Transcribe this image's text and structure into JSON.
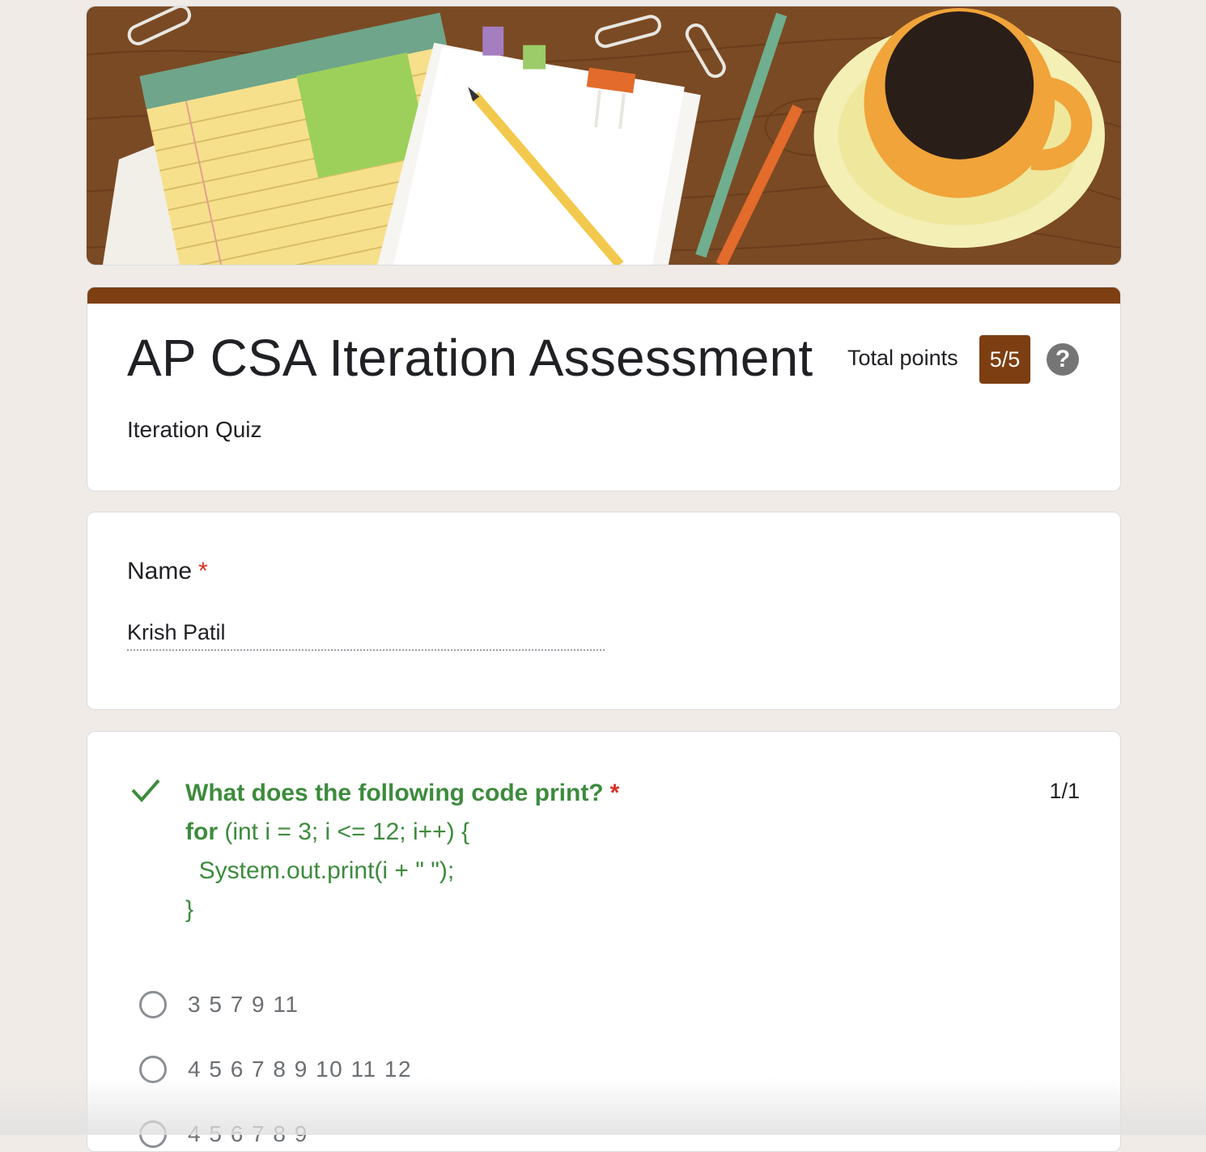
{
  "header": {
    "title": "AP CSA Iteration Assessment",
    "description": "Iteration Quiz",
    "total_points_label": "Total points",
    "score": "5/5",
    "help": "?"
  },
  "name_question": {
    "label": "Name",
    "required_mark": "*",
    "answer": "Krish Patil"
  },
  "question1": {
    "title": "What does the following code print?",
    "required_mark": "*",
    "code_keyword": "for",
    "code_line1_rest": " (int i = 3; i <= 12; i++) {",
    "code_line2": "  System.out.print(i + \" \");",
    "code_line3": "}",
    "points": "1/1",
    "options": [
      "3 5 7 9 11",
      "4 5 6 7 8 9 10 11 12",
      "4  5 6 7 8 9"
    ]
  },
  "colors": {
    "accent": "#7d3e12",
    "correct": "#3d8b3d",
    "required": "#d93025",
    "background": "#f0ebe7"
  }
}
